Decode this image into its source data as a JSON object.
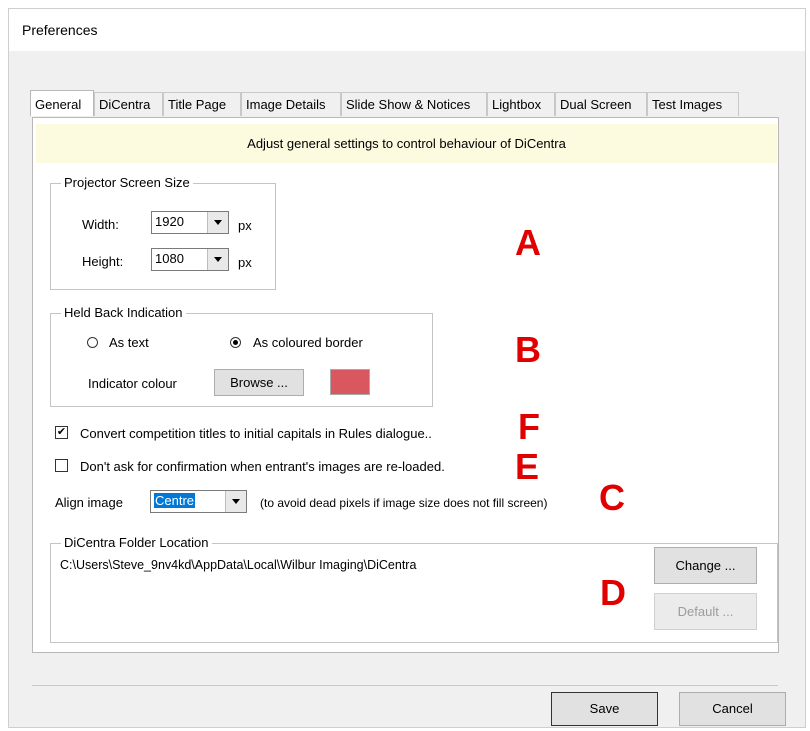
{
  "window": {
    "title": "Preferences"
  },
  "tabs": [
    {
      "label": "General",
      "active": true
    },
    {
      "label": "DiCentra",
      "active": false
    },
    {
      "label": "Title Page",
      "active": false
    },
    {
      "label": "Image Details",
      "active": false
    },
    {
      "label": "Slide Show & Notices",
      "active": false
    },
    {
      "label": "Lightbox",
      "active": false
    },
    {
      "label": "Dual Screen",
      "active": false
    },
    {
      "label": "Test Images",
      "active": false
    }
  ],
  "banner": "Adjust general settings to control behaviour of DiCentra",
  "projector": {
    "legend": "Projector Screen Size",
    "width_label": "Width:",
    "width_value": "1920",
    "height_label": "Height:",
    "height_value": "1080",
    "unit": "px"
  },
  "held_back": {
    "legend": "Held Back Indication",
    "option_text": "As text",
    "option_border": "As coloured border",
    "selected": "As coloured border",
    "indicator_label": "Indicator colour",
    "browse_label": "Browse ...",
    "indicator_color": "#d9585f"
  },
  "options": {
    "convert_titles_label": "Convert competition titles to initial capitals in Rules dialogue..",
    "convert_titles_checked": true,
    "no_confirm_label": "Don't ask for confirmation when entrant's images are re-loaded.",
    "no_confirm_checked": false
  },
  "align": {
    "label": "Align image",
    "value": "Centre",
    "hint": "(to avoid dead pixels if image size does not fill screen)"
  },
  "folder": {
    "legend": "DiCentra Folder Location",
    "path": "C:\\Users\\Steve_9nv4kd\\AppData\\Local\\Wilbur Imaging\\DiCentra",
    "change_label": "Change ...",
    "default_label": "Default ..."
  },
  "footer": {
    "save_label": "Save",
    "cancel_label": "Cancel"
  },
  "annotations": {
    "a": "A",
    "b": "B",
    "f": "F",
    "e": "E",
    "c": "C",
    "d": "D"
  }
}
